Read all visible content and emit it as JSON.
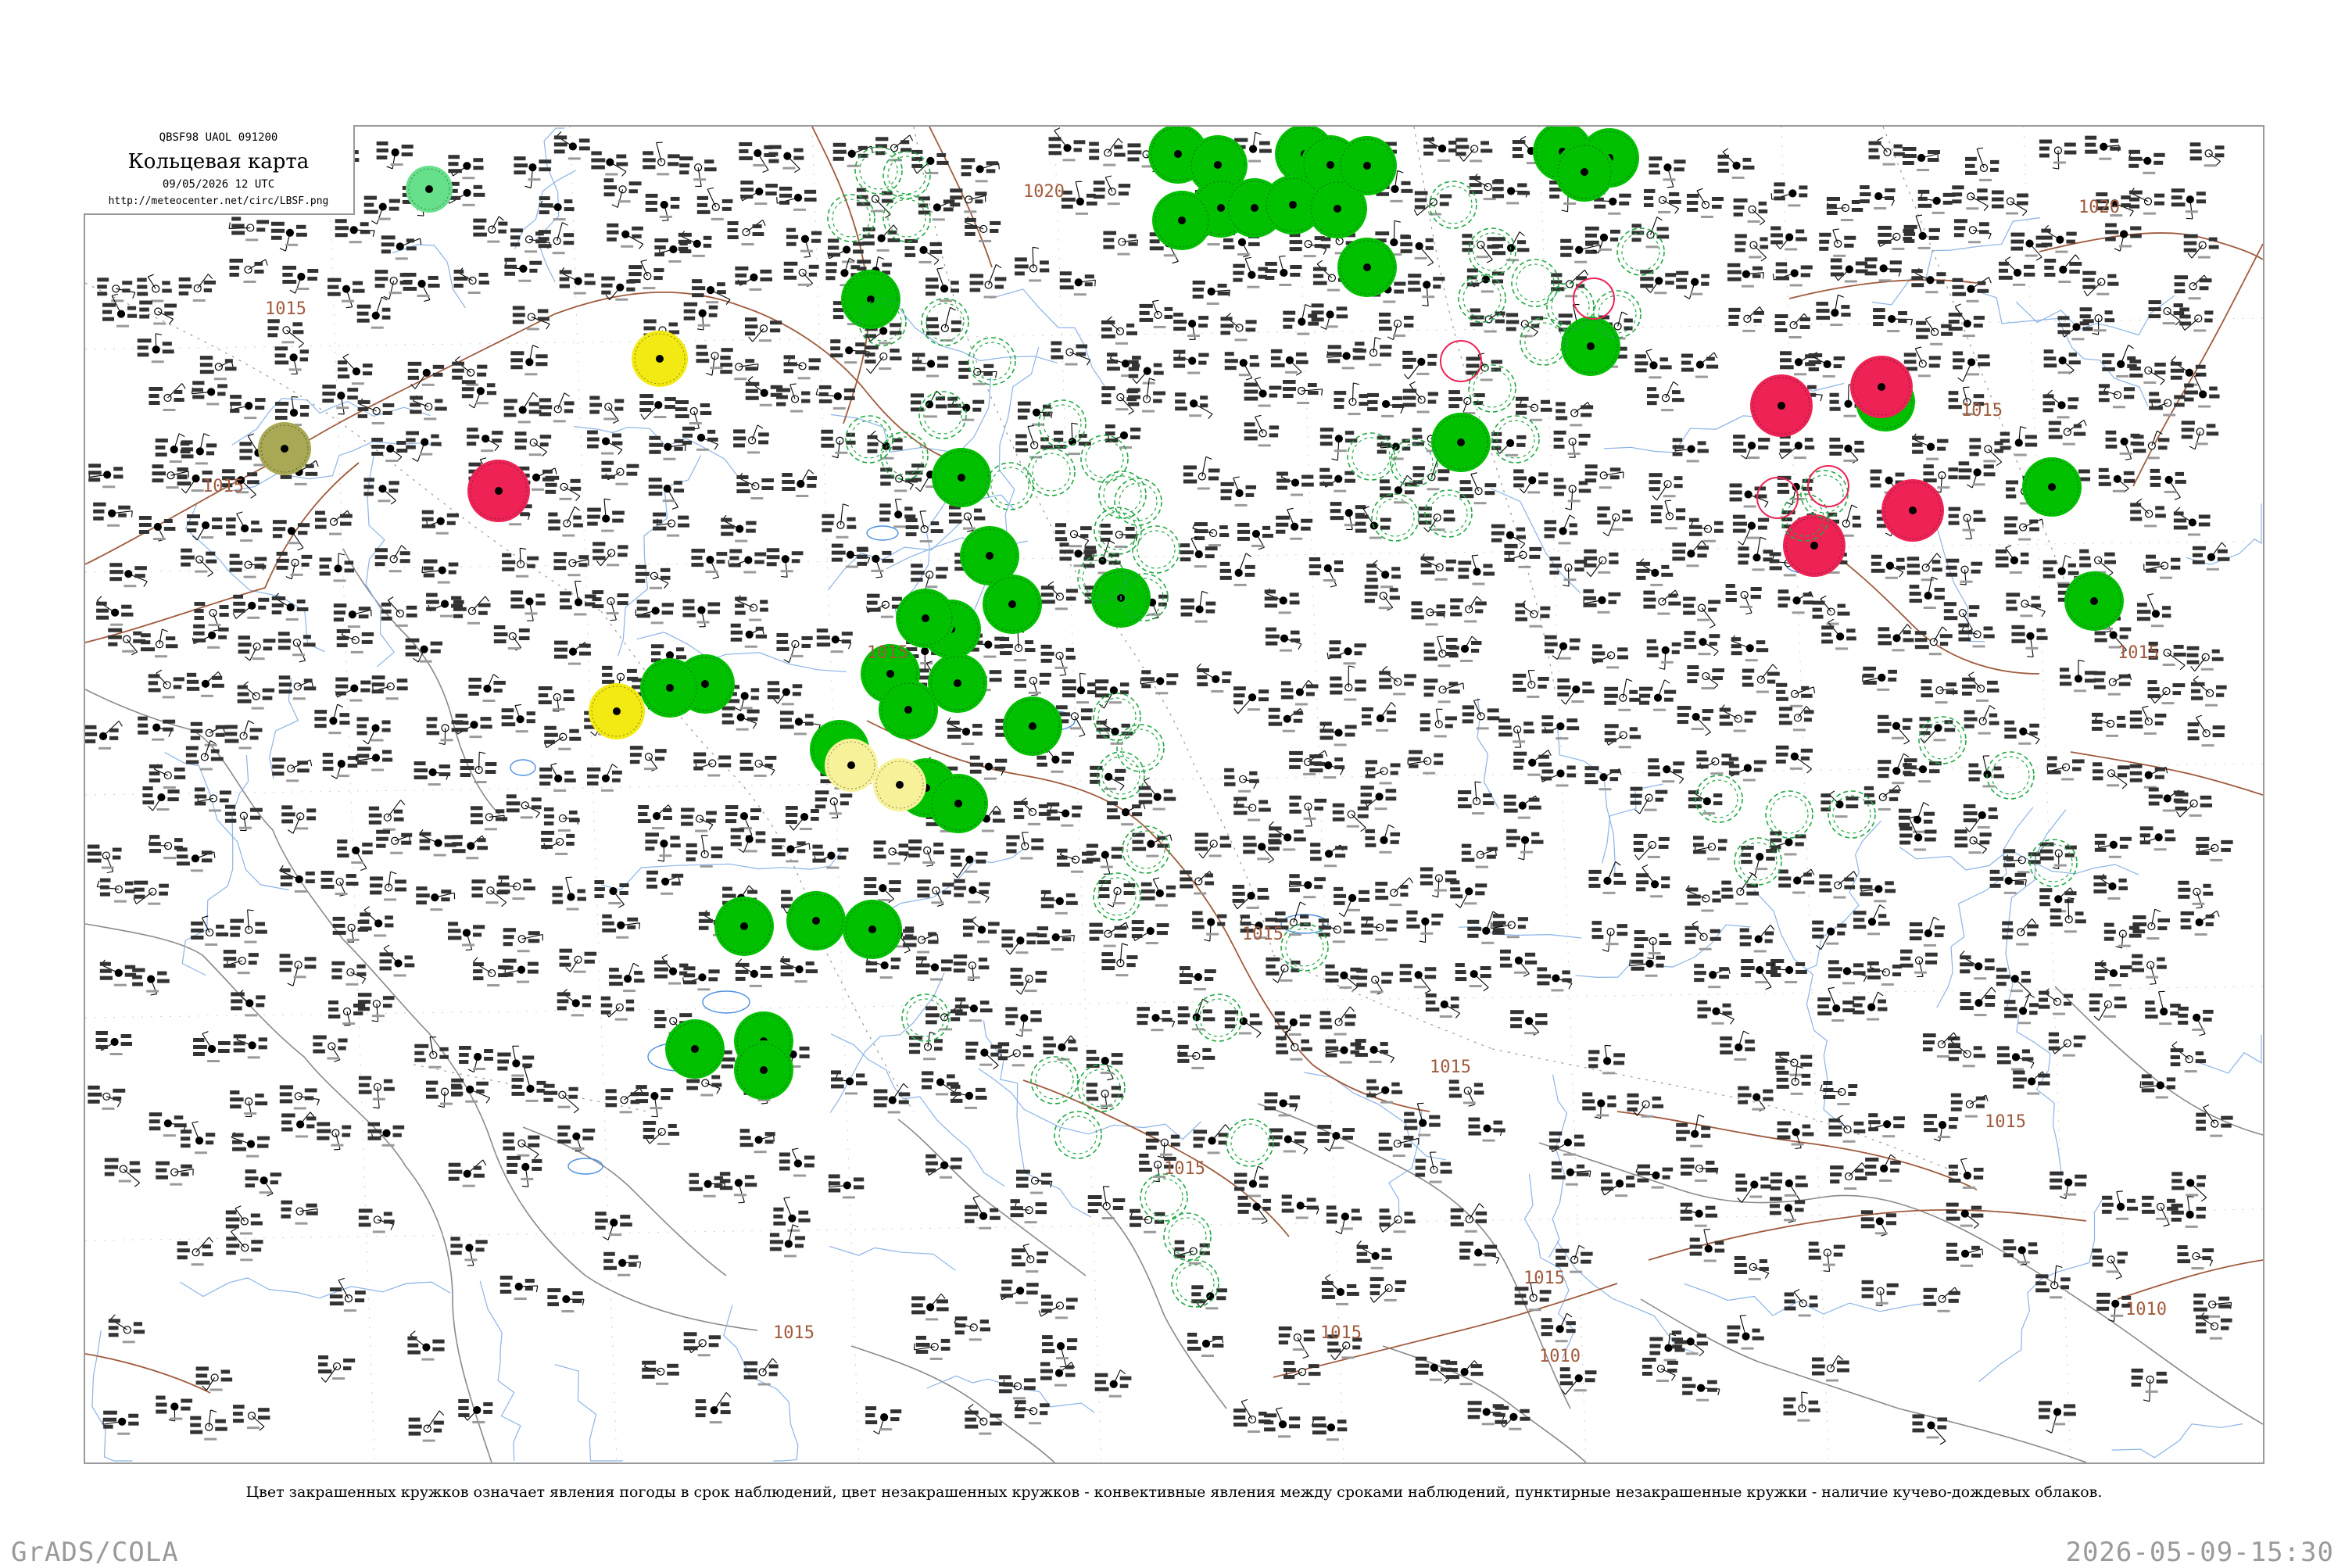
{
  "header": {
    "code": "QBSF98  UAOL  091200",
    "title": "Кольцевая карта",
    "time": "09/05/2026 12 UTC",
    "url": "http://meteocenter.net/circ/LBSF.png"
  },
  "caption": "Цвет закрашенных кружков означает явления погоды в срок наблюдений, цвет незакрашенных кружков - конвективные явления между сроками наблюдений, пунктирные незакрашенные кружки - наличие кучево-дождевых облаков.",
  "footer": {
    "left": "GrADS/COLA",
    "right": "2026-05-09-15:30"
  },
  "isobar_labels": [
    "1015",
    "1015",
    "1015",
    "1020",
    "1015",
    "1015",
    "1015",
    "1015",
    "1015",
    "1020",
    "1015",
    "1015",
    "1010",
    "1015",
    "1010",
    "1015"
  ],
  "colors": {
    "frame": "#9a9a9a",
    "coast": "#8a8a8a",
    "river": "#8ab4e8",
    "isobar": "#a05a3c",
    "border": "#9a9a9a",
    "station": "#000000",
    "rain_green": "#00c000",
    "light_green": "#66e08a",
    "thunder_red": "#ee2255",
    "haze_yellow": "#f2ea12",
    "pale_yellow": "#f7f29a",
    "olive": "#a8a855",
    "cb_dashed": "#22aa44"
  },
  "marker_legend": [
    {
      "kind": "filled",
      "meaning": "явления погоды в срок наблюдений"
    },
    {
      "kind": "outline",
      "meaning": "конвективные явления между сроками наблюдений"
    },
    {
      "kind": "dashed-outline",
      "meaning": "наличие кучево-дождевых облаков"
    }
  ]
}
